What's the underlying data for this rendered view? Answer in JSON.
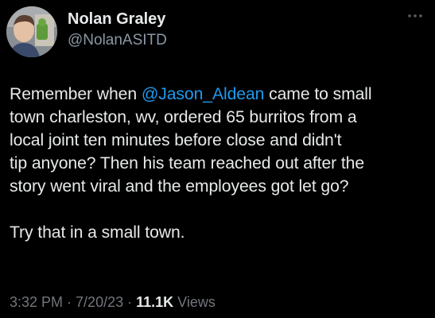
{
  "author": {
    "display_name": "Nolan Graley",
    "handle": "@NolanASITD"
  },
  "tweet": {
    "line1_pre": "Remember when ",
    "mention": "@Jason_Aldean",
    "line1_post": " came to small",
    "line2": "town charleston, wv, ordered 65 burritos from a",
    "line3": "local joint ten minutes before close and didn't",
    "line4": "tip anyone? Then his team reached out after the",
    "line5": "story went viral and the employees got let go?",
    "line6": "Try that in a small town."
  },
  "meta": {
    "time": "3:32 PM",
    "sep1": " · ",
    "date": "7/20/23",
    "sep2": " · ",
    "views_count": "11.1K",
    "views_label": " Views"
  },
  "colors": {
    "background": "#000000",
    "text": "#e7e9ea",
    "secondary": "#71767b",
    "link": "#1d9bf0"
  },
  "icons": {
    "more": "more-dots-icon"
  }
}
